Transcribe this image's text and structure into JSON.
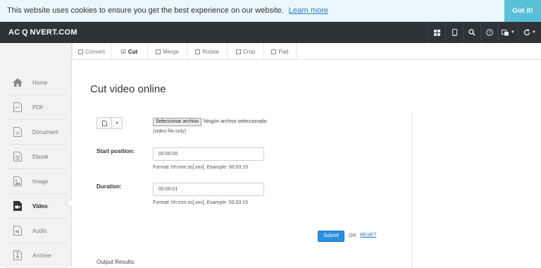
{
  "cookie_bar": {
    "message": "This website uses cookies to ensure you get the best experience on our website.",
    "learn_more": "Learn more",
    "accept": "Got it!"
  },
  "header": {
    "logo": "AC Q NVERT.COM",
    "icons": [
      "grid-icon",
      "mobile-icon",
      "search-icon",
      "help-icon",
      "language-icon",
      "refresh-icon"
    ]
  },
  "sidebar": {
    "items": [
      {
        "label": "Home",
        "icon": "home-icon"
      },
      {
        "label": "PDF",
        "icon": "pdf-icon"
      },
      {
        "label": "Document",
        "icon": "document-icon"
      },
      {
        "label": "Ebook",
        "icon": "ebook-icon"
      },
      {
        "label": "Image",
        "icon": "image-icon"
      },
      {
        "label": "Video",
        "icon": "video-icon",
        "active": true
      },
      {
        "label": "Audio",
        "icon": "audio-icon"
      },
      {
        "label": "Archive",
        "icon": "archive-icon"
      }
    ]
  },
  "tabs": [
    {
      "label": "Convert",
      "state": "unchecked"
    },
    {
      "label": "Cut",
      "state": "checked",
      "active": true
    },
    {
      "label": "Merge",
      "state": "unchecked"
    },
    {
      "label": "Rotate",
      "state": "unchecked"
    },
    {
      "label": "Crop",
      "state": "unchecked"
    },
    {
      "label": "Pad",
      "state": "unchecked"
    }
  ],
  "main": {
    "title": "Cut video online",
    "file": {
      "button": "Seleccionar archivo",
      "status": "Ningún archivo seleccionado",
      "hint": "(video file only)"
    },
    "start": {
      "label": "Start position:",
      "value": "00:00:00",
      "format": "Format: hh:mm:ss[.xxx]. Example: 00:03:15"
    },
    "duration": {
      "label": "Duration:",
      "value": "00:00:01",
      "format": "Format: hh:mm:ss[.xxx]. Example: 00:03:15"
    },
    "submit": "Submit",
    "or": "OR",
    "reset": "RESET",
    "output": "Output Results:"
  },
  "colors": {
    "header_bg": "#2e3338",
    "cookie_bg": "#eaf7fb",
    "cookie_button": "#58c0d8",
    "primary": "#2d8fe0",
    "link": "#2b7bbf"
  }
}
